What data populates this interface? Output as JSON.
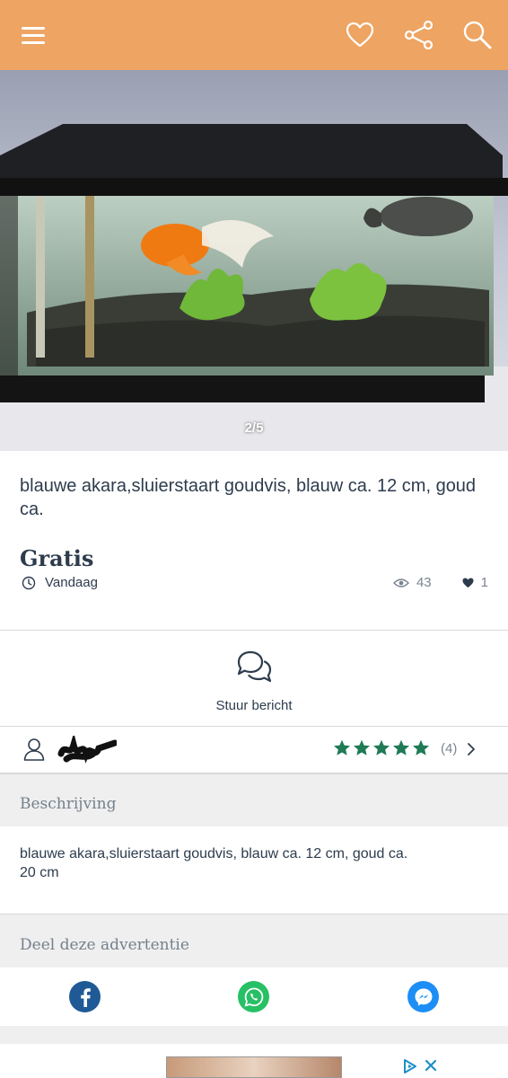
{
  "colors": {
    "header": "#eea462",
    "stars": "#1f7a55",
    "text": "#2d3c4d"
  },
  "header": {
    "icons": [
      "menu-icon",
      "heart-icon",
      "share-icon",
      "search-icon"
    ]
  },
  "photo": {
    "counter": "2/5"
  },
  "listing": {
    "title": "blauwe akara,sluierstaart goudvis, blauw ca. 12 cm, goud ca.",
    "price": "Gratis",
    "date": "Vandaag",
    "views": "43",
    "favorites": "1"
  },
  "message": {
    "label": "Stuur bericht"
  },
  "seller": {
    "rating": 5,
    "rating_count": "(4)"
  },
  "description": {
    "heading": "Beschrijving",
    "line1": "blauwe akara,sluierstaart goudvis, blauw ca. 12 cm, goud ca.",
    "line2": "20 cm"
  },
  "share": {
    "heading": "Deel deze advertentie",
    "networks": [
      "facebook-icon",
      "whatsapp-icon",
      "messenger-icon"
    ]
  }
}
